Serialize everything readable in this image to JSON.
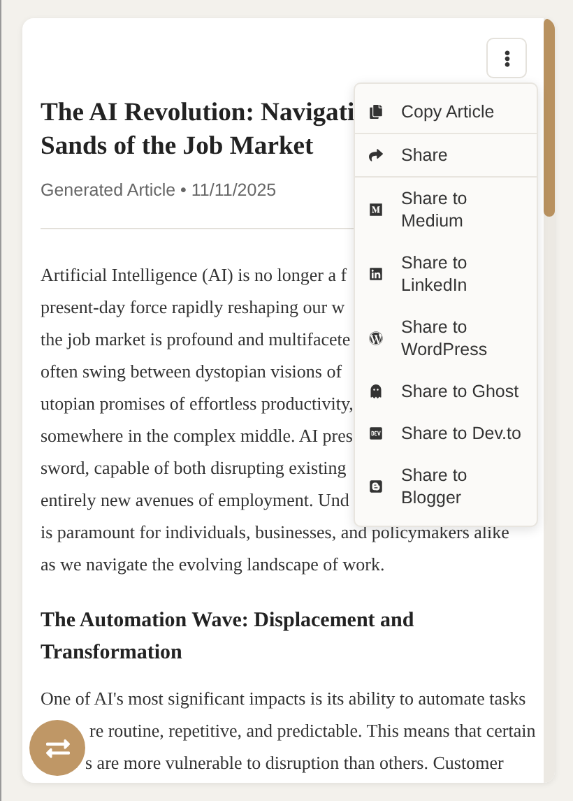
{
  "article": {
    "title_lines": [
      "The AI Revolution: Navigati",
      "Sands of the Job Market"
    ],
    "meta": "Generated Article • 11/11/2025",
    "intro_lines": [
      "Artificial Intelligence (AI) is no longer a f",
      "present-day force rapidly reshaping our w",
      "the job market is profound and multifacete",
      "often swing between dystopian visions of",
      "utopian promises of effortless productivity,",
      "somewhere in the complex middle. AI pres",
      "sword, capable of both disrupting existing",
      "entirely new avenues of employment. Und",
      "is paramount for individuals, businesses, and policymakers alike",
      "as we navigate the evolving landscape of work."
    ],
    "heading": "The Automation Wave: Displacement and Transformation",
    "section_lines": [
      "One of AI's most significant impacts is its ability to automate tasks",
      "re routine, repetitive, and predictable. This means that certain",
      "s are more vulnerable to disruption than others. Customer"
    ]
  },
  "menu": {
    "items": [
      {
        "lines": [
          "Copy Article"
        ]
      },
      {
        "lines": [
          "Share"
        ]
      },
      {
        "lines": [
          "Share to",
          "Medium"
        ]
      },
      {
        "lines": [
          "Share to",
          "LinkedIn"
        ]
      },
      {
        "lines": [
          "Share to",
          "WordPress"
        ]
      },
      {
        "lines": [
          "Share to Ghost"
        ]
      },
      {
        "lines": [
          "Share to Dev.to"
        ]
      },
      {
        "lines": [
          "Share to",
          "Blogger"
        ]
      }
    ]
  }
}
